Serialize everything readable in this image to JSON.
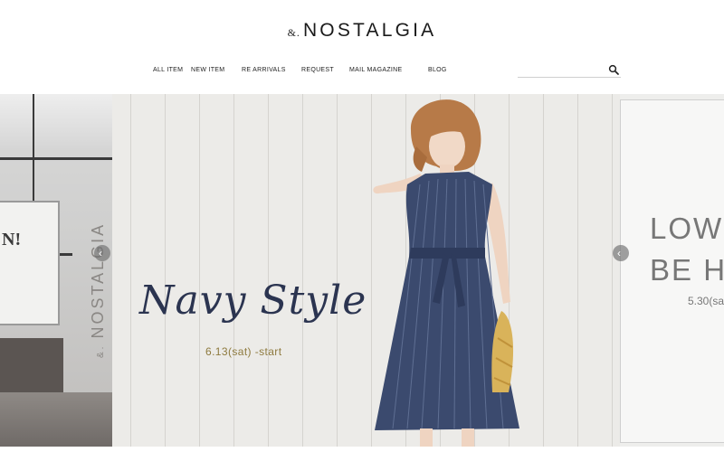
{
  "header": {
    "logo_amp": "&.",
    "logo_word": "NOSTALGIA"
  },
  "nav": {
    "items": [
      "ALL ITEM",
      "NEW ITEM",
      "RE ARRIVALS",
      "REQUEST",
      "MAIL MAGAZINE",
      "BLOG"
    ]
  },
  "search": {
    "placeholder": "",
    "value": "",
    "icon": "search-icon"
  },
  "hero": {
    "left_slide": {
      "panel_text": "N!",
      "brand_amp": "&.",
      "brand_word": "NOSTALGIA"
    },
    "main_slide": {
      "title": "Navy Style",
      "date": "6.13(sat) -start",
      "title_color": "#2b3450",
      "date_color": "#8e7a3e"
    },
    "right_slide": {
      "line1": "LOW",
      "line2": "BE HA",
      "date": "5.30(sa"
    },
    "prev_arrow": "‹",
    "next_arrow": "‹"
  },
  "colors": {
    "background": "#ffffff",
    "text": "#222222",
    "navy": "#2b3450"
  }
}
